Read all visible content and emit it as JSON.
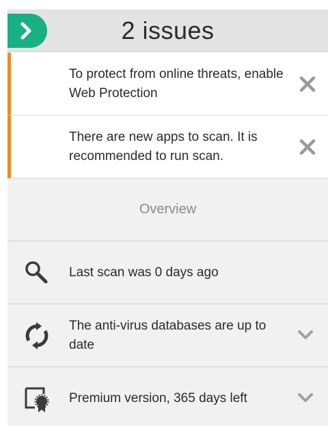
{
  "header": {
    "title": "2 issues",
    "expand_icon": "chevron-right-icon",
    "accent_color": "#19b083"
  },
  "issues": [
    {
      "text": "To protect from online threats, enable Web Protection",
      "close_icon": "close-icon"
    },
    {
      "text": "There are new apps to scan. It is recommended to run scan.",
      "close_icon": "close-icon"
    }
  ],
  "issue_accent_color": "#f28a1c",
  "overview": {
    "label": "Overview"
  },
  "status_rows": [
    {
      "text": "Last scan was 0 days ago",
      "icon": "search-icon"
    },
    {
      "text": "The anti-virus databases are up to date",
      "icon": "sync-icon",
      "chevron": "chevron-down-icon"
    },
    {
      "text": "Premium version, 365 days left",
      "icon": "license-certificate-icon",
      "chevron": "chevron-down-icon"
    }
  ]
}
